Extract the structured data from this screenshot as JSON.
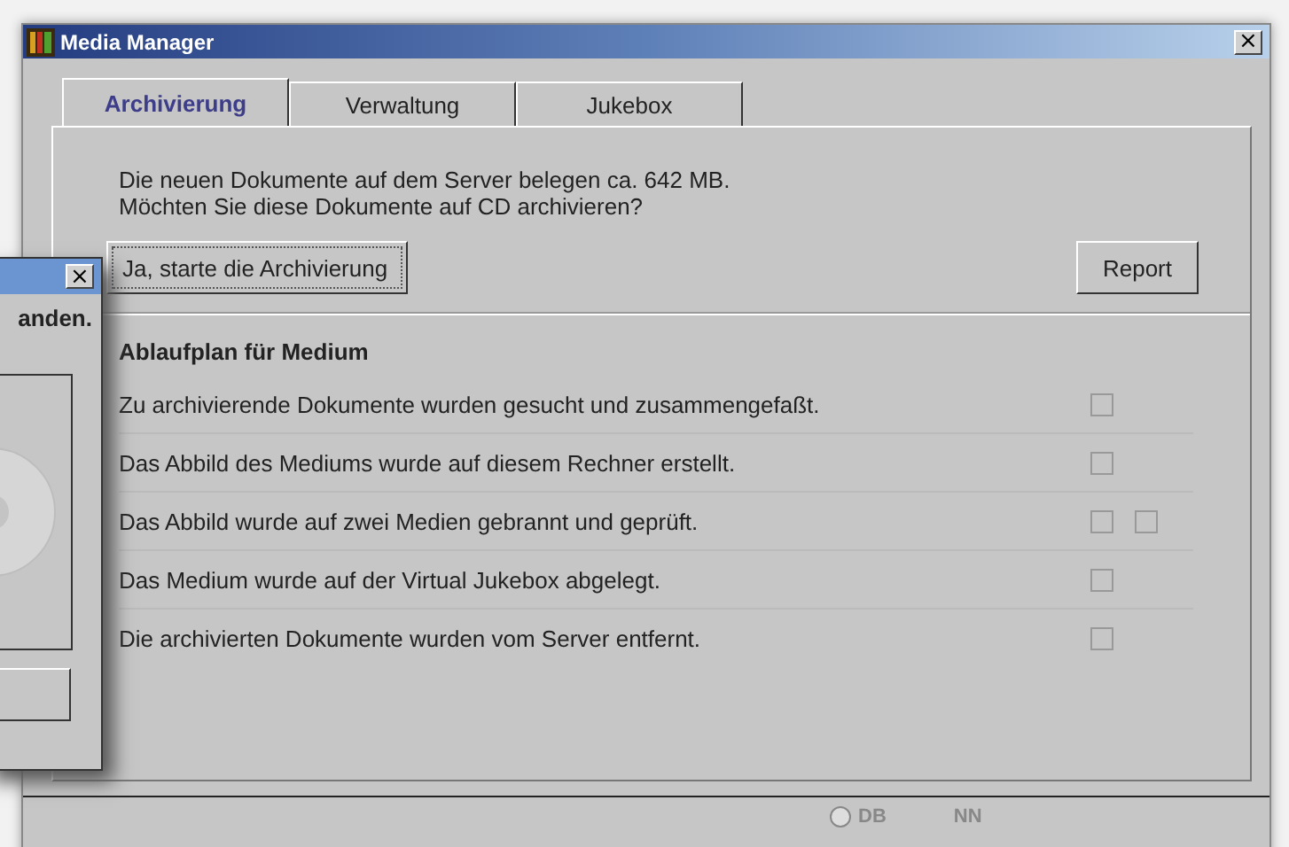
{
  "window": {
    "title": "Media Manager",
    "close": "×"
  },
  "tabs": [
    {
      "label": "Archivierung",
      "selected": true
    },
    {
      "label": "Verwaltung",
      "selected": false
    },
    {
      "label": "Jukebox",
      "selected": false
    }
  ],
  "message": [
    "Die neuen Dokumente auf dem Server belegen ca. 642 MB.",
    "Möchten Sie diese Dokumente auf CD archivieren?"
  ],
  "start_button": "Ja, starte die Archivierung",
  "report_button": "Report",
  "plan": {
    "title": "Ablaufplan für Medium",
    "steps": [
      {
        "text": "Zu archivierende Dokumente wurden gesucht und zusammengefaßt.",
        "checks": [
          {
            "checked": false
          }
        ]
      },
      {
        "text": "Das Abbild des Mediums wurde auf diesem Rechner erstellt.",
        "checks": [
          {
            "checked": false
          }
        ]
      },
      {
        "text": "Das Abbild wurde auf zwei Medien gebrannt und geprüft.",
        "checks": [
          {
            "checked": false
          },
          {
            "checked": false
          }
        ]
      },
      {
        "text": "Das Medium wurde auf der Virtual Jukebox abgelegt.",
        "checks": [
          {
            "checked": false
          }
        ]
      },
      {
        "text": "Die archivierten Dokumente wurden vom Server entfernt.",
        "checks": [
          {
            "checked": false
          }
        ]
      }
    ]
  },
  "status_bar": [
    {
      "kind": "indicator",
      "label": "DB",
      "on": false
    },
    {
      "kind": "text",
      "label": "NN"
    }
  ],
  "dialog": {
    "close": "×",
    "message": "anden."
  }
}
